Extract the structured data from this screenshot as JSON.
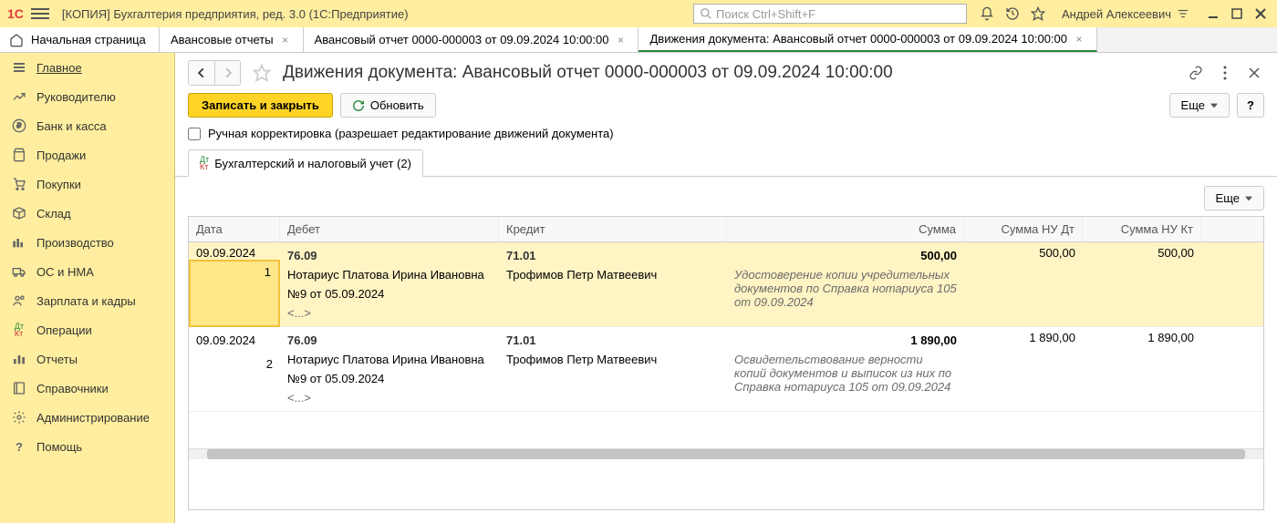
{
  "titlebar": {
    "app_title": "[КОПИЯ] Бухгалтерия предприятия, ред. 3.0  (1С:Предприятие)",
    "search_placeholder": "Поиск Ctrl+Shift+F",
    "user_name": "Андрей Алексеевич"
  },
  "tabs": {
    "home": "Начальная страница",
    "items": [
      {
        "label": "Авансовые отчеты"
      },
      {
        "label": "Авансовый отчет 0000-000003 от 09.09.2024 10:00:00"
      },
      {
        "label": "Движения документа: Авансовый отчет 0000-000003 от 09.09.2024 10:00:00"
      }
    ]
  },
  "sidebar": {
    "items": [
      {
        "label": "Главное"
      },
      {
        "label": "Руководителю"
      },
      {
        "label": "Банк и касса"
      },
      {
        "label": "Продажи"
      },
      {
        "label": "Покупки"
      },
      {
        "label": "Склад"
      },
      {
        "label": "Производство"
      },
      {
        "label": "ОС и НМА"
      },
      {
        "label": "Зарплата и кадры"
      },
      {
        "label": "Операции"
      },
      {
        "label": "Отчеты"
      },
      {
        "label": "Справочники"
      },
      {
        "label": "Администрирование"
      },
      {
        "label": "Помощь"
      }
    ]
  },
  "page": {
    "title": "Движения документа: Авансовый отчет 0000-000003 от 09.09.2024 10:00:00",
    "write_close": "Записать и закрыть",
    "refresh": "Обновить",
    "more": "Еще",
    "help": "?",
    "manual_edit": "Ручная корректировка (разрешает редактирование движений документа)",
    "doc_tab": "Бухгалтерский и налоговый учет (2)"
  },
  "grid": {
    "more": "Еще",
    "head": {
      "date": "Дата",
      "debit": "Дебет",
      "credit": "Кредит",
      "sum": "Сумма",
      "nu_dt": "Сумма НУ Дт",
      "nu_kt": "Сумма НУ Кт"
    },
    "rows": [
      {
        "date": "09.09.2024",
        "num": "1",
        "debit_acct": "76.09",
        "debit_l1": "Нотариус Платова Ирина Ивановна",
        "debit_l2": "№9 от 05.09.2024",
        "debit_l3": "<...>",
        "credit_acct": "71.01",
        "credit_l1": "Трофимов Петр Матвеевич",
        "sum": "500,00",
        "desc": "Удостоверение копии учредительных документов по Справка нотариуса 105 от 09.09.2024",
        "nu_dt": "500,00",
        "nu_kt": "500,00"
      },
      {
        "date": "09.09.2024",
        "num": "2",
        "debit_acct": "76.09",
        "debit_l1": "Нотариус Платова Ирина Ивановна",
        "debit_l2": "№9 от 05.09.2024",
        "debit_l3": "<...>",
        "credit_acct": "71.01",
        "credit_l1": "Трофимов Петр Матвеевич",
        "sum": "1 890,00",
        "desc": "Освидетельствование верности копий документов и выписок из них  по Справка нотариуса 105 от 09.09.2024",
        "nu_dt": "1 890,00",
        "nu_kt": "1 890,00"
      }
    ]
  }
}
